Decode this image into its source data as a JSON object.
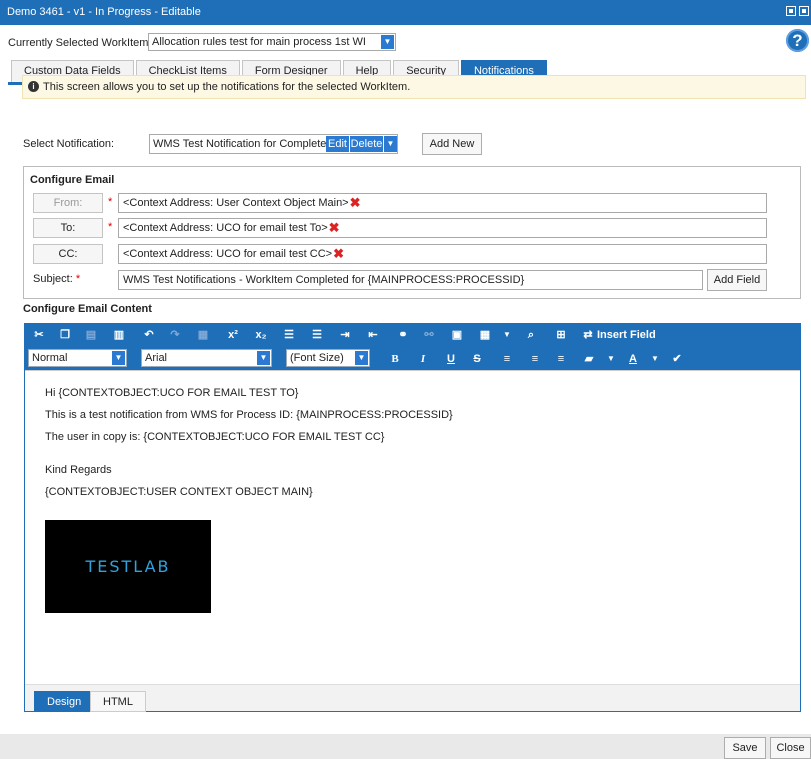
{
  "window": {
    "title": "Demo 3461 - v1 - In Progress - Editable"
  },
  "workitem": {
    "label": "Currently Selected WorkItem",
    "value": "Allocation rules test for main process 1st WI"
  },
  "help": {
    "symbol": "?"
  },
  "tabs": [
    {
      "label": "Custom Data Fields"
    },
    {
      "label": "CheckList Items"
    },
    {
      "label": "Form Designer"
    },
    {
      "label": "Help"
    },
    {
      "label": "Security"
    },
    {
      "label": "Notifications"
    }
  ],
  "info": {
    "message": "This screen allows you to set up the notifications for the selected WorkItem."
  },
  "notification": {
    "label": "Select Notification:",
    "value": "WMS Test Notification for Completed W",
    "edit_label": "Edit",
    "delete_label": "Delete",
    "add_new_label": "Add New"
  },
  "configure_email": {
    "legend": "Configure Email",
    "from_label": "From:",
    "from_value": "<Context Address: User Context Object Main>",
    "to_label": "To:",
    "to_value": "<Context Address: UCO for email test To>",
    "cc_label": "CC:",
    "cc_value": "<Context Address: UCO for email test CC>",
    "required_mark": "*",
    "subject_label": "Subject:",
    "subject_value": "WMS Test Notifications - WorkItem Completed for  {MAINPROCESS:PROCESSID}",
    "add_field_label": "Add Field"
  },
  "email_content": {
    "legend": "Configure Email Content",
    "insert_field_label": "Insert Field",
    "format_select": "Normal",
    "font_select": "Arial",
    "size_select": "(Font Size)",
    "lines": [
      "Hi {CONTEXTOBJECT:UCO FOR EMAIL TEST TO}",
      "This is a test notification from WMS for Process ID: {MAINPROCESS:PROCESSID}",
      "The user in copy is: {CONTEXTOBJECT:UCO FOR EMAIL TEST CC}",
      "Kind Regards",
      "{CONTEXTOBJECT:USER CONTEXT OBJECT MAIN}"
    ],
    "logo_text": "TESTLAB",
    "design_tab": "Design",
    "html_tab": "HTML"
  },
  "footer": {
    "save_label": "Save",
    "close_label": "Close"
  },
  "colors": {
    "accent": "#1f6fb8",
    "info_bg": "#fcf8e3",
    "required": "#dd0000"
  }
}
